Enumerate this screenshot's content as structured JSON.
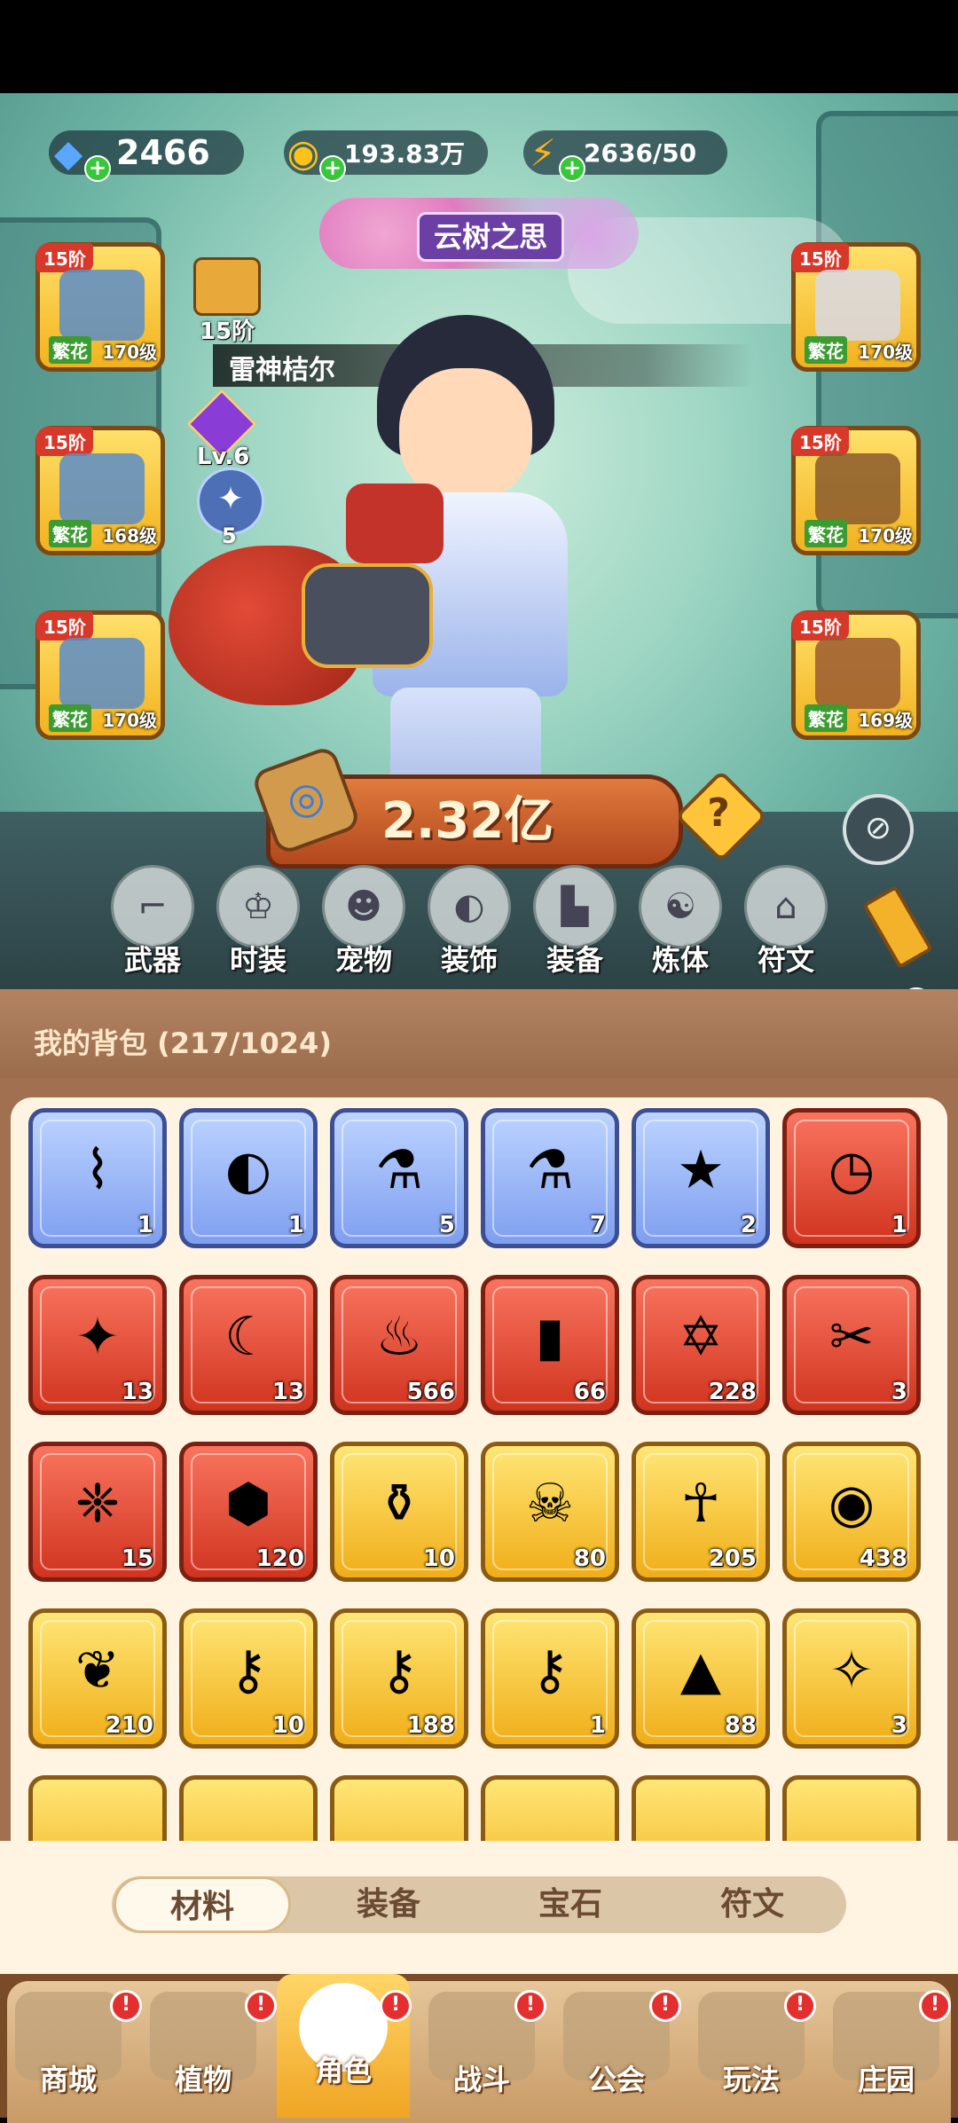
{
  "resources": {
    "gems": "2466",
    "gold": "193.83万",
    "energy": "2636/50"
  },
  "banner": {
    "title": "云树之思"
  },
  "character": {
    "stage": "15阶",
    "name": "雷神桔尔",
    "level": "Lv.6",
    "count": "5",
    "power": "2.32亿"
  },
  "equipment_left": [
    {
      "stage": "15阶",
      "tag": "繁花",
      "level": "170级"
    },
    {
      "stage": "15阶",
      "tag": "繁花",
      "level": "168级"
    },
    {
      "stage": "15阶",
      "tag": "繁花",
      "level": "170级"
    }
  ],
  "equipment_right": [
    {
      "stage": "15阶",
      "tag": "繁花",
      "level": "170级"
    },
    {
      "stage": "15阶",
      "tag": "繁花",
      "level": "170级"
    },
    {
      "stage": "15阶",
      "tag": "繁花",
      "level": "169级"
    }
  ],
  "char_tabs": [
    "武器",
    "时装",
    "宠物",
    "装饰",
    "装备",
    "炼体",
    "符文"
  ],
  "bag": {
    "title": "我的背包 (217/1024)",
    "items": [
      {
        "rarity": "blue",
        "icon": "flute-icon",
        "count": "1"
      },
      {
        "rarity": "blue",
        "icon": "mask-icon",
        "count": "1"
      },
      {
        "rarity": "blue",
        "icon": "potion-vial-icon",
        "count": "5"
      },
      {
        "rarity": "blue",
        "icon": "cloud-vial-icon",
        "count": "7"
      },
      {
        "rarity": "blue",
        "icon": "star-badge-icon",
        "count": "2"
      },
      {
        "rarity": "red",
        "icon": "clock-book-icon",
        "count": "1"
      },
      {
        "rarity": "red",
        "icon": "crystal-star-icon",
        "count": "13"
      },
      {
        "rarity": "red",
        "icon": "moon-star-icon",
        "count": "13"
      },
      {
        "rarity": "red",
        "icon": "red-potion-icon",
        "count": "566"
      },
      {
        "rarity": "red",
        "icon": "green-tube-icon",
        "count": "66"
      },
      {
        "rarity": "red",
        "icon": "hexagram-icon",
        "count": "228"
      },
      {
        "rarity": "red",
        "icon": "scissors-icon",
        "count": "3"
      },
      {
        "rarity": "red",
        "icon": "knot-icon",
        "count": "15"
      },
      {
        "rarity": "red",
        "icon": "cube-cluster-icon",
        "count": "120"
      },
      {
        "rarity": "gold",
        "icon": "gold-flask-icon",
        "count": "10"
      },
      {
        "rarity": "gold",
        "icon": "skull-scroll-icon",
        "count": "80"
      },
      {
        "rarity": "gold",
        "icon": "ankh-icon",
        "count": "205"
      },
      {
        "rarity": "gold",
        "icon": "gold-coin-icon",
        "count": "438"
      },
      {
        "rarity": "gold",
        "icon": "leaf-bundle-icon",
        "count": "210"
      },
      {
        "rarity": "gold",
        "icon": "ruby-key-icon",
        "count": "10"
      },
      {
        "rarity": "gold",
        "icon": "ornate-key-icon",
        "count": "188"
      },
      {
        "rarity": "gold",
        "icon": "emerald-key-icon",
        "count": "1"
      },
      {
        "rarity": "gold",
        "icon": "pyramid-icon",
        "count": "88"
      },
      {
        "rarity": "gold",
        "icon": "purple-orb-icon",
        "count": "3"
      }
    ]
  },
  "bag_tabs": [
    "材料",
    "装备",
    "宝石",
    "符文"
  ],
  "nav": [
    "商城",
    "植物",
    "角色",
    "战斗",
    "公会",
    "玩法",
    "庄园"
  ],
  "badge": "!"
}
